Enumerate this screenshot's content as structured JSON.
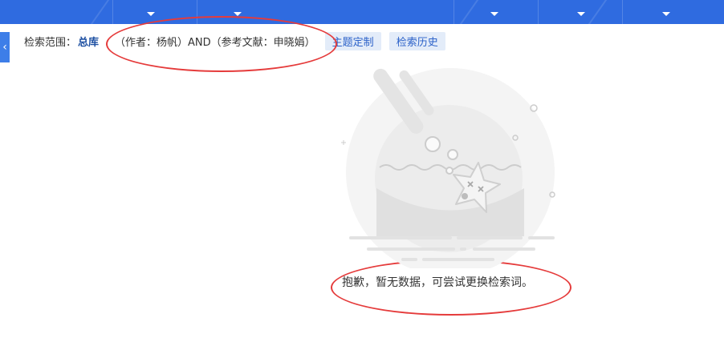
{
  "header": {
    "nav_caret_icons": [
      "chevron-down-icon",
      "chevron-down-icon",
      "chevron-down-icon",
      "chevron-down-icon",
      "chevron-down-icon"
    ]
  },
  "back_button": {
    "icon": "chevron-left-icon",
    "glyph": "‹"
  },
  "search": {
    "scope_label": "检索范围：",
    "scope_value": "总库",
    "query": "（作者：杨帆）AND（参考文献：申晓娟）",
    "theme_button": "主题定制",
    "history_button": "检索历史"
  },
  "empty_state": {
    "illustration": "starfish-bowl-illustration",
    "message": "抱歉，暂无数据，可尝试更换检索词。"
  },
  "colors": {
    "topbar": "#2f6be0",
    "accent": "#1e50a2",
    "button_bg": "#e3ecf9",
    "annotation_red": "#e53b3b"
  }
}
